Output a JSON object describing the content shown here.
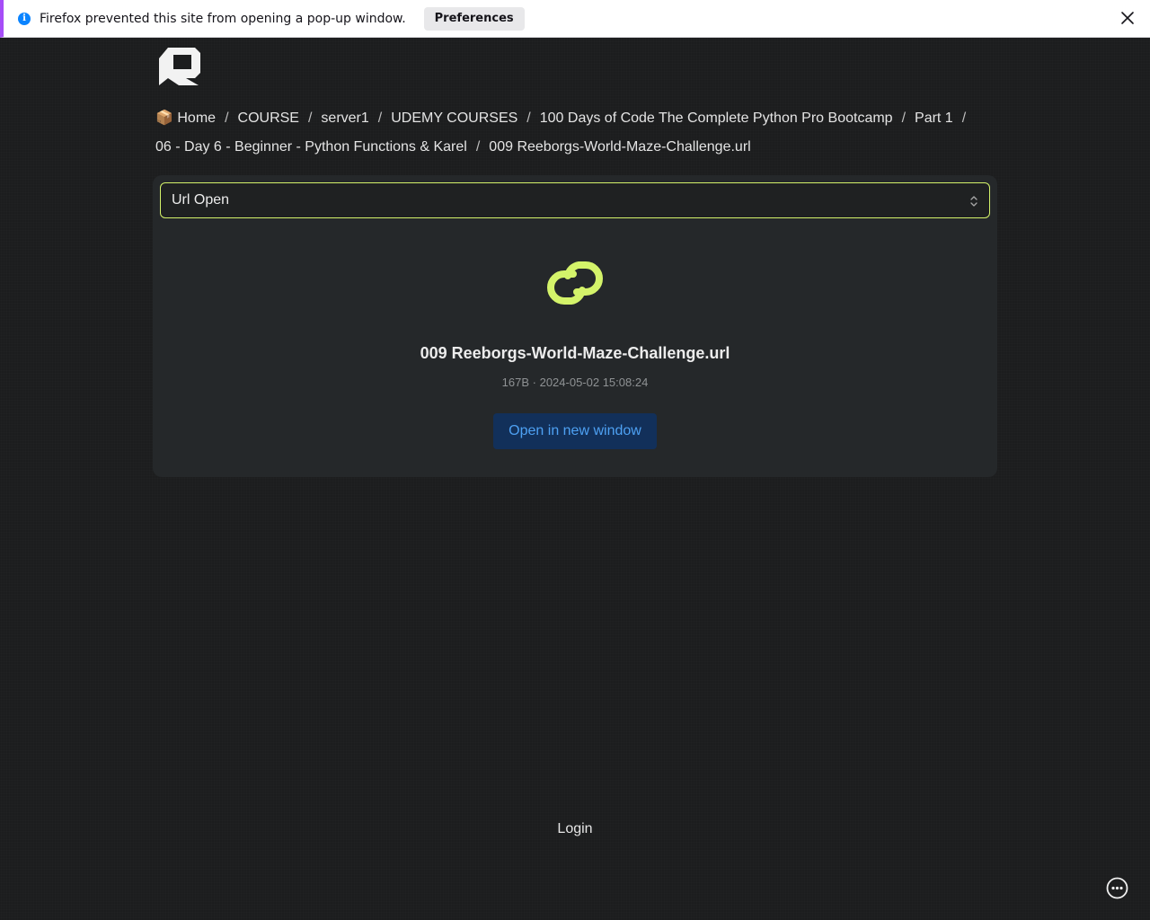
{
  "notification": {
    "message": "Firefox prevented this site from opening a pop-up window.",
    "preferences_label": "Preferences",
    "info_icon": "info-icon",
    "close_icon": "close-icon"
  },
  "breadcrumb": {
    "home_emoji": "📦",
    "items": [
      "Home",
      "COURSE",
      "server1",
      "UDEMY COURSES",
      "100 Days of Code The Complete Python Pro Bootcamp",
      "Part 1",
      "06 - Day 6 - Beginner - Python Functions & Karel",
      "009 Reeborgs-World-Maze-Challenge.url"
    ],
    "separator": "/"
  },
  "viewer": {
    "selected_mode": "Url Open",
    "file_name": "009 Reeborgs-World-Maze-Challenge.url",
    "file_meta": "167B · 2024-05-02 15:08:24",
    "open_button_label": "Open in new window",
    "icon": "link-icon"
  },
  "footer": {
    "login_label": "Login"
  },
  "colors": {
    "accent": "#d4f36a",
    "button_text": "#4ea1f3",
    "button_bg": "#12305a",
    "background": "#1c1d1e",
    "card": "#25282a"
  }
}
